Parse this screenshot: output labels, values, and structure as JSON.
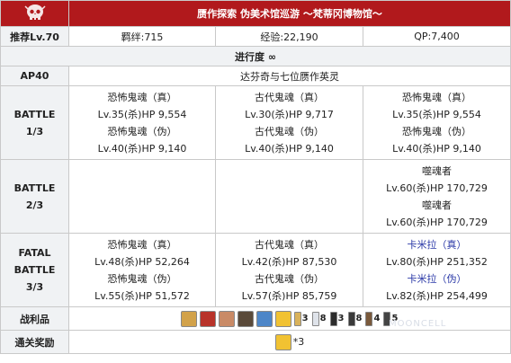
{
  "header": {
    "title": "赝作探索 伪美术馆巡游 ～梵蒂冈博物馆～",
    "logo_icon": "skull-emblem-icon"
  },
  "info_row": {
    "label": "推荐Lv.70",
    "bond": "羁绊:715",
    "exp": "经验:22,190",
    "qp": "QP:7,400"
  },
  "progress": "进行度 ∞",
  "ap": {
    "label": "AP40",
    "quest": "达芬奇与七位赝作英灵"
  },
  "battles": [
    {
      "label_lines": [
        "BATTLE",
        "1/3"
      ],
      "cols": [
        [
          {
            "name": "恐怖鬼魂（真）",
            "stat": "Lv.35(杀)HP 9,554"
          },
          {
            "name": "恐怖鬼魂（伪）",
            "stat": "Lv.40(杀)HP 9,140"
          }
        ],
        [
          {
            "name": "古代鬼魂（真）",
            "stat": "Lv.30(杀)HP 9,717"
          },
          {
            "name": "古代鬼魂（伪）",
            "stat": "Lv.40(杀)HP 9,140"
          }
        ],
        [
          {
            "name": "恐怖鬼魂（真）",
            "stat": "Lv.35(杀)HP 9,554"
          },
          {
            "name": "恐怖鬼魂（伪）",
            "stat": "Lv.40(杀)HP 9,140"
          }
        ]
      ]
    },
    {
      "label_lines": [
        "BATTLE",
        "2/3"
      ],
      "cols": [
        [],
        [],
        [
          {
            "name": "噬魂者",
            "stat": "Lv.60(杀)HP 170,729"
          },
          {
            "name": "噬魂者",
            "stat": "Lv.60(杀)HP 170,729"
          }
        ]
      ]
    },
    {
      "label_lines": [
        "FATAL",
        "BATTLE",
        "3/3"
      ],
      "cols": [
        [
          {
            "name": "恐怖鬼魂（真）",
            "stat": "Lv.48(杀)HP 52,264"
          },
          {
            "name": "恐怖鬼魂（伪）",
            "stat": "Lv.55(杀)HP 51,572"
          }
        ],
        [
          {
            "name": "古代鬼魂（真）",
            "stat": "Lv.42(杀)HP 87,530"
          },
          {
            "name": "古代鬼魂（伪）",
            "stat": "Lv.57(杀)HP 85,759"
          }
        ],
        [
          {
            "name": "卡米拉（真）",
            "stat": "Lv.80(杀)HP 251,352",
            "link": true
          },
          {
            "name": "卡米拉（伪）",
            "stat": "Lv.82(杀)HP 254,499",
            "link": true
          }
        ]
      ]
    }
  ],
  "drops": {
    "label": "战利品",
    "items": [
      {
        "icon": "craft-essence-red-icon",
        "count": "",
        "color": "#d2a24a"
      },
      {
        "icon": "craft-essence-flame-icon",
        "count": "",
        "color": "#b8332a"
      },
      {
        "icon": "craft-essence-girl-icon",
        "count": "",
        "color": "#c98a66"
      },
      {
        "icon": "craft-essence-dark-icon",
        "count": "",
        "color": "#5a4a3a"
      },
      {
        "icon": "craft-essence-blue-icon",
        "count": "",
        "color": "#4d86c8"
      },
      {
        "icon": "mana-prism-icon",
        "count": "",
        "color": "#f1c232"
      },
      {
        "icon": "event-token-gold-icon",
        "count": "3",
        "color": "#d9b25a"
      },
      {
        "icon": "event-token-white-icon",
        "count": "8",
        "color": "#dfe3ea"
      },
      {
        "icon": "event-token-black-icon",
        "count": "3",
        "color": "#2c2c2c"
      },
      {
        "icon": "event-token-black2-icon",
        "count": "8",
        "color": "#3a3a3a"
      },
      {
        "icon": "event-token-brown-icon",
        "count": "4",
        "color": "#7a5a3c"
      },
      {
        "icon": "event-token-dark-icon",
        "count": "5",
        "color": "#444444"
      }
    ]
  },
  "reward": {
    "label": "通关奖励",
    "icon": "mana-prism-reward-icon",
    "count": "*3"
  },
  "watermark": "MOONCELL"
}
